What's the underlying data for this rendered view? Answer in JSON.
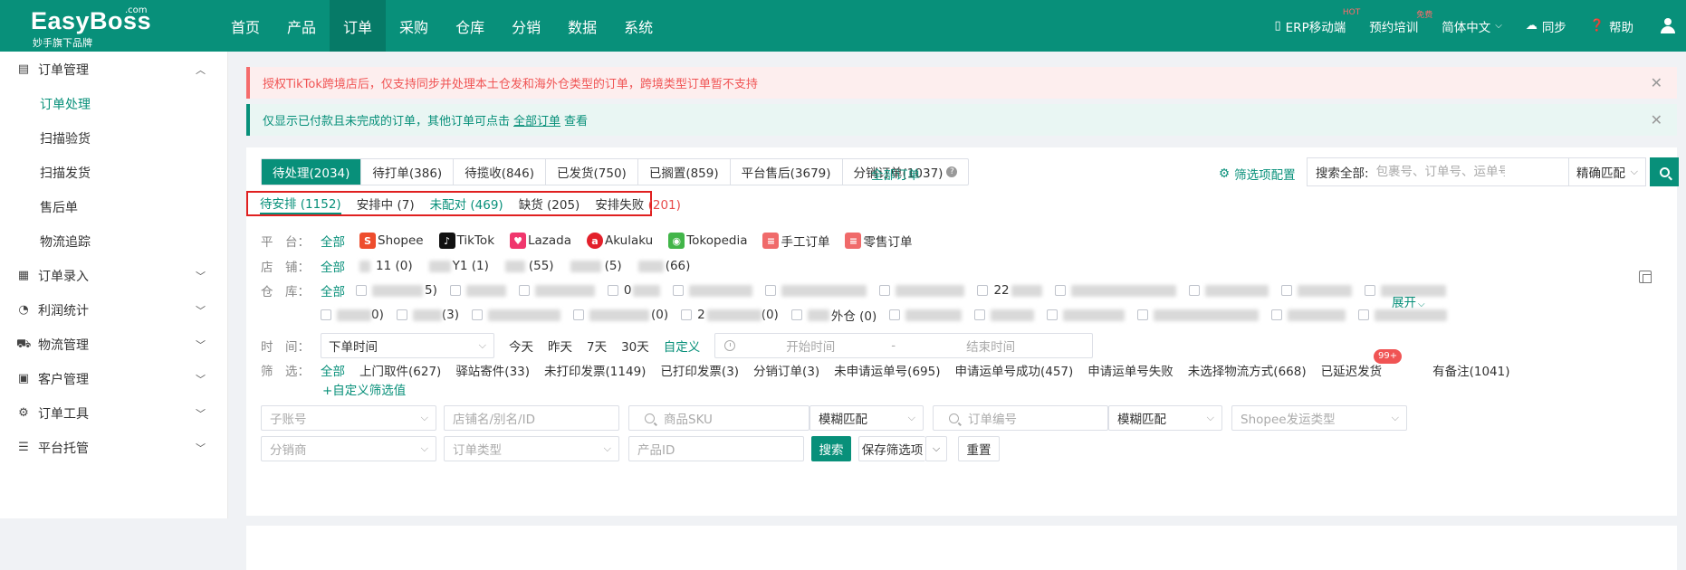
{
  "brand": {
    "name": "EasyBoss",
    "com": ".com",
    "sub": "妙手旗下品牌"
  },
  "nav": [
    "首页",
    "产品",
    "订单",
    "采购",
    "仓库",
    "分销",
    "数据",
    "系统"
  ],
  "topright": {
    "erp": "ERP移动端",
    "erp_sup": "HOT",
    "training": "预约培训",
    "training_sup": "免费",
    "lang": "简体中文",
    "sync": "同步",
    "help": "帮助"
  },
  "sidebar": {
    "order_mgmt": "订单管理",
    "subs": [
      "订单处理",
      "扫描验货",
      "扫描发货",
      "售后单",
      "物流追踪"
    ],
    "groups": [
      "订单录入",
      "利润统计",
      "物流管理",
      "客户管理",
      "订单工具",
      "平台托管"
    ]
  },
  "alerts": {
    "red": "授权TikTok跨境店后，仅支持同步并处理本土仓发和海外仓类型的订单，跨境类型订单暂不支持",
    "green_pre": "仅显示已付款且未完成的订单，其他订单可点击",
    "green_link": "全部订单",
    "green_post": "查看"
  },
  "tabs": [
    "待处理(2034)",
    "待打单(386)",
    "待揽收(846)",
    "已发货(750)",
    "已搁置(859)",
    "平台售后(3679)",
    "分销订单(1037)"
  ],
  "all_orders": "全部订单",
  "filter_config": "筛选项配置",
  "search": {
    "label": "搜索全部:",
    "placeholder": "包裹号、订单号、运单号",
    "match": "精确匹配"
  },
  "subtabs": {
    "pending": "待安排 (1152)",
    "arranging": "安排中 (7)",
    "unmatched": "未配对 (469)",
    "shortage_label": "缺货",
    "shortage_count": "(205)",
    "failed_label": "安排失败",
    "failed_count": "(201)"
  },
  "filters": {
    "platform_label": "平　台：",
    "all": "全部",
    "platforms": [
      "Shopee",
      "TikTok",
      "Lazada",
      "Akulaku",
      "Tokopedia",
      "手工订单",
      "零售订单"
    ],
    "shop_label": "店　铺：",
    "shops": [
      "11 (0)",
      "Y1 (1)",
      "(55)",
      "(5)",
      "(66)"
    ],
    "warehouse_label": "仓　库：",
    "warehouses_row1": [
      "5)",
      "",
      "",
      "0",
      "",
      "",
      "",
      "22",
      "",
      "",
      "",
      "",
      ""
    ],
    "warehouses_row2": [
      "0)",
      "(3)",
      "",
      "(0)",
      "2",
      "(0)",
      "",
      "(0)",
      "",
      "",
      "",
      "",
      "",
      ""
    ],
    "warehouse_visible": [
      "外仓 (0)"
    ],
    "expand": "展开",
    "time_label": "时　间：",
    "time_type": "下单时间",
    "time_opts": [
      "今天",
      "昨天",
      "7天",
      "30天"
    ],
    "custom": "自定义",
    "start_time": "开始时间",
    "dash": "-",
    "end_time": "结束时间",
    "filter_label": "筛　选：",
    "filter_opts": [
      "上门取件(627)",
      "驿站寄件(33)",
      "未打印发票(1149)",
      "已打印发票(3)",
      "分销订单(3)",
      "未申请运单号(695)",
      "申请运单号成功(457)",
      "申请运单号失败",
      "未选择物流方式(668)",
      "已延迟发货"
    ],
    "delayed_badge": "99+",
    "has_note": "有备注(1041)",
    "custom_filter": "+自定义筛选值"
  },
  "controls": {
    "subaccount": "子账号",
    "shop_alias": "店铺名/别名/ID",
    "product_sku": "商品SKU",
    "fuzzy1": "模糊匹配",
    "order_no": "订单编号",
    "fuzzy2": "模糊匹配",
    "shopee_ship": "Shopee发运类型",
    "distributor": "分销商",
    "order_type": "订单类型",
    "product_id": "产品ID",
    "search_btn": "搜索",
    "save_filter": "保存筛选项",
    "reset": "重置"
  },
  "colors": {
    "brand": "#08907a",
    "alert_red": "#f05454",
    "highlight_border": "#e02020"
  }
}
